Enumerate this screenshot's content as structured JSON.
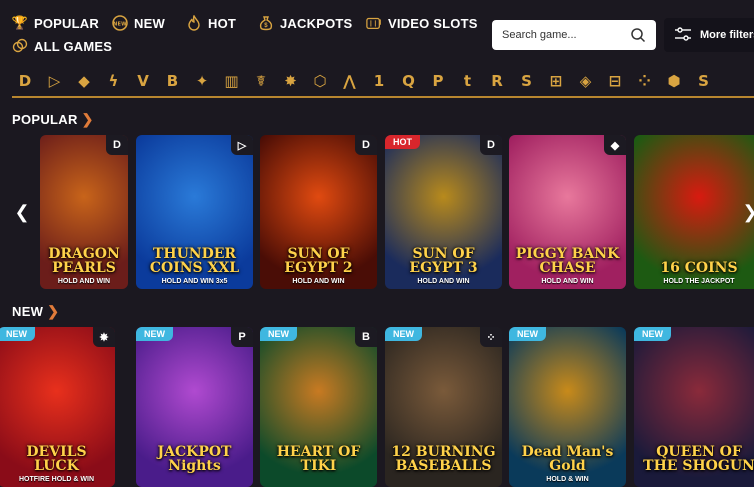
{
  "nav": {
    "popular": "POPULAR",
    "new": "NEW",
    "hot": "HOT",
    "jackpots": "JACKPOTS",
    "video_slots": "VIDEO SLOTS",
    "all_games": "ALL GAMES"
  },
  "search": {
    "placeholder": "Search game..."
  },
  "filters": {
    "label": "More filters"
  },
  "providers": [
    "D",
    "▷",
    "◆",
    "ϟ",
    "V",
    "B",
    "✦",
    "▥",
    "☤",
    "✸",
    "⬡",
    "⋀",
    "1",
    "Q",
    "P",
    "t",
    "R",
    "S",
    "⊞",
    "◈",
    "⊟",
    "⁘",
    "⬢",
    "S"
  ],
  "sections": {
    "popular": "POPULAR",
    "new": "NEW"
  },
  "popular_games": [
    {
      "title": "DRAGON PEARLS",
      "sub": "HOLD AND WIN",
      "badge": "",
      "provider": "D",
      "colors": [
        "#6b1d1a",
        "#c8641a"
      ]
    },
    {
      "title": "THUNDER COINS XXL",
      "sub": "HOLD AND WIN 3x5",
      "badge": "",
      "provider": "▷",
      "colors": [
        "#0b3b9c",
        "#2a7ad8"
      ]
    },
    {
      "title": "SUN OF EGYPT 2",
      "sub": "HOLD AND WIN",
      "badge": "",
      "provider": "D",
      "colors": [
        "#4a0d06",
        "#e04a10"
      ]
    },
    {
      "title": "SUN OF EGYPT 3",
      "sub": "HOLD AND WIN",
      "badge": "HOT",
      "provider": "D",
      "colors": [
        "#1a2b5c",
        "#b88a1c"
      ]
    },
    {
      "title": "PIGGY BANK CHASE",
      "sub": "HOLD AND WIN",
      "badge": "",
      "provider": "◆",
      "colors": [
        "#a02060",
        "#e8789c"
      ]
    },
    {
      "title": "16 COINS",
      "sub": "HOLD THE JACKPOT",
      "badge": "",
      "provider": "",
      "colors": [
        "#1d5a12",
        "#d81a10"
      ]
    }
  ],
  "new_games": [
    {
      "title": "DEVILS LUCK",
      "sub": "HOTFIRE HOLD & WIN",
      "badge": "NEW",
      "provider": "✸",
      "colors": [
        "#8a0c18",
        "#e8301c"
      ]
    },
    {
      "title": "JACKPOT Nights",
      "sub": "",
      "badge": "NEW",
      "provider": "P",
      "colors": [
        "#4a1c8a",
        "#b04ad0"
      ]
    },
    {
      "title": "HEART OF TIKI",
      "sub": "",
      "badge": "NEW",
      "provider": "B",
      "colors": [
        "#0c4a2a",
        "#c87a22"
      ]
    },
    {
      "title": "12 BURNING BASEBALLS",
      "sub": "",
      "badge": "NEW",
      "provider": "⁘",
      "colors": [
        "#2a2520",
        "#7a5a3a"
      ]
    },
    {
      "title": "Dead Man's Gold",
      "sub": "HOLD & WIN",
      "badge": "NEW",
      "provider": "",
      "colors": [
        "#0a3a5a",
        "#c88a1a"
      ]
    },
    {
      "title": "QUEEN OF THE SHOGUN",
      "sub": "",
      "badge": "NEW",
      "provider": "",
      "colors": [
        "#1a1a3a",
        "#8a2a3a"
      ]
    }
  ],
  "colors": {
    "accent": "#d9a441",
    "new_badge": "#3fb7e0",
    "hot_badge": "#d8262c",
    "background": "#1b1820"
  }
}
